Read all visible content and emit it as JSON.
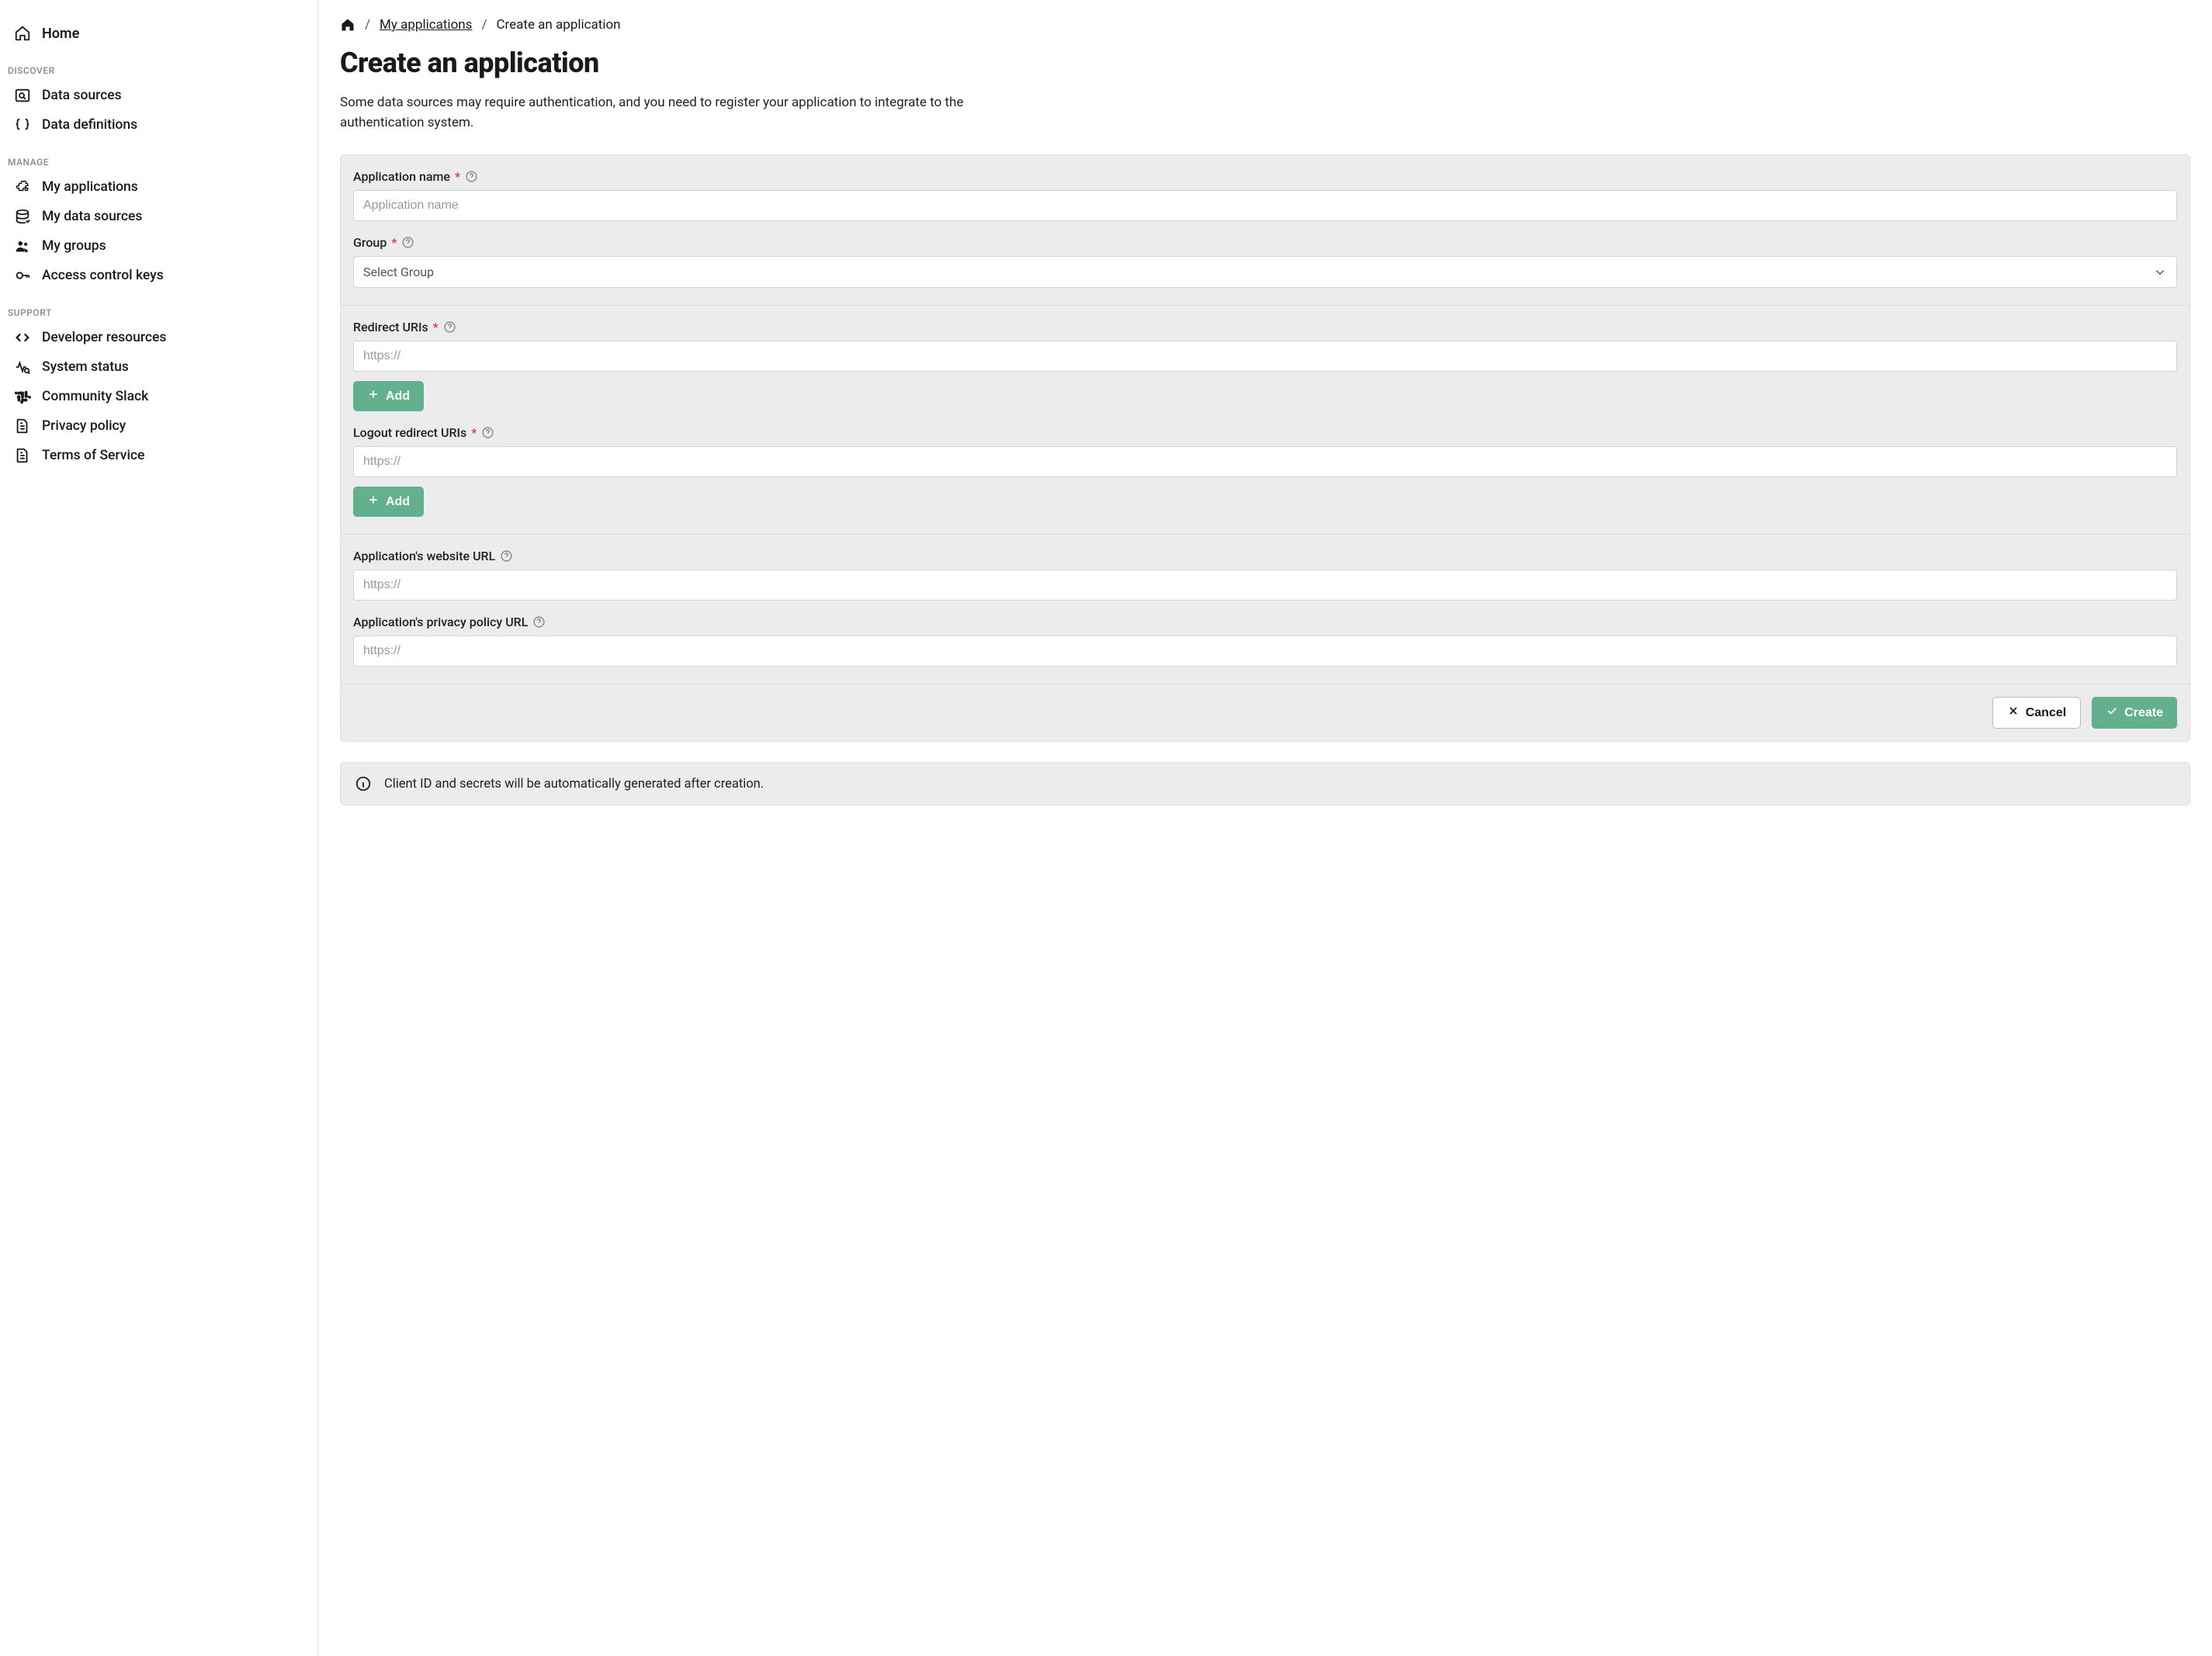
{
  "sidebar": {
    "home": "Home",
    "sections": {
      "discover": {
        "label": "DISCOVER",
        "items": [
          "Data sources",
          "Data definitions"
        ]
      },
      "manage": {
        "label": "MANAGE",
        "items": [
          "My applications",
          "My data sources",
          "My groups",
          "Access control keys"
        ]
      },
      "support": {
        "label": "SUPPORT",
        "items": [
          "Developer resources",
          "System status",
          "Community Slack",
          "Privacy policy",
          "Terms of Service"
        ]
      }
    }
  },
  "breadcrumb": {
    "link": "My applications",
    "current": "Create an application"
  },
  "page": {
    "title": "Create an application",
    "desc": "Some data sources may require authentication, and you need to register your application to integrate to the authentication system."
  },
  "form": {
    "app_name": {
      "label": "Application name",
      "placeholder": "Application name"
    },
    "group": {
      "label": "Group",
      "placeholder": "Select Group"
    },
    "redirect": {
      "label": "Redirect URIs",
      "placeholder": "https://",
      "add": "Add"
    },
    "logout_redirect": {
      "label": "Logout redirect URIs",
      "placeholder": "https://",
      "add": "Add"
    },
    "website": {
      "label": "Application's website URL",
      "placeholder": "https://"
    },
    "privacy": {
      "label": "Application's privacy policy URL",
      "placeholder": "https://"
    }
  },
  "actions": {
    "cancel": "Cancel",
    "create": "Create"
  },
  "info": "Client ID and secrets will be automatically generated after creation."
}
